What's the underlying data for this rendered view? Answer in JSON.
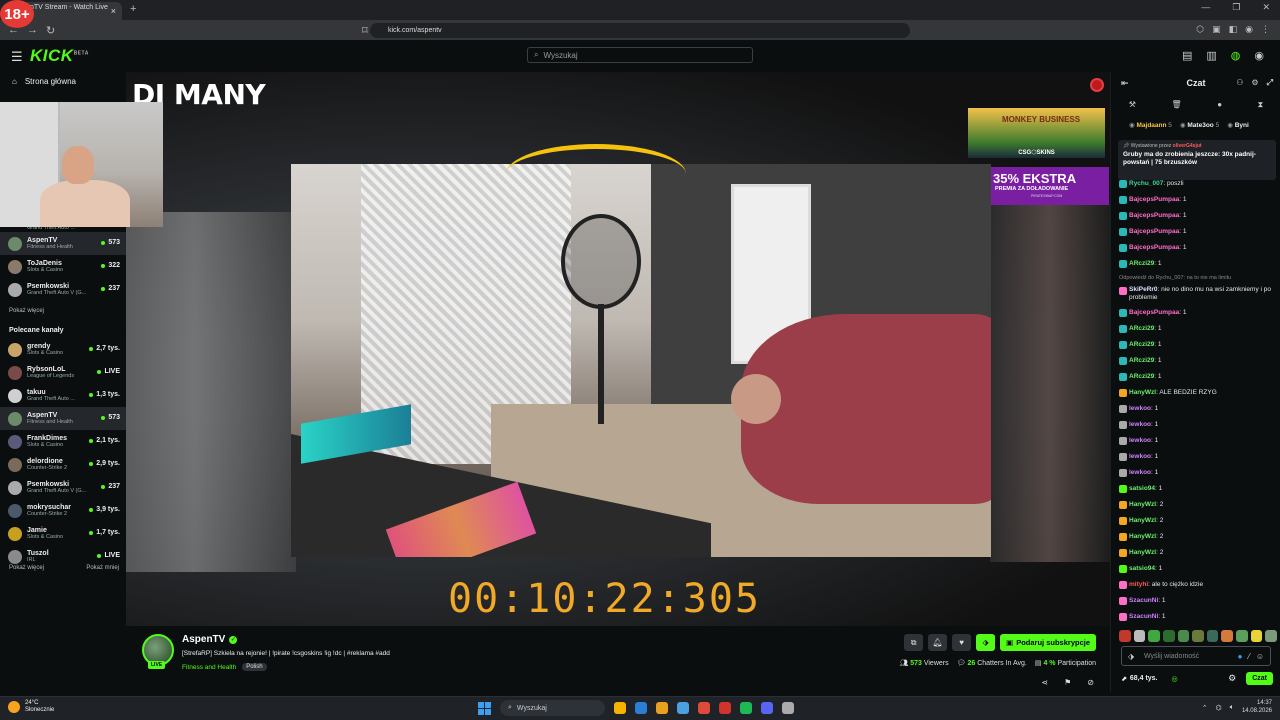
{
  "browser": {
    "age_badge": "18+",
    "tab_title": "nTV Stream - Watch Live o",
    "tab_close": "×",
    "new_tab": "+",
    "url": "kick.com/aspentv",
    "window_controls": [
      "—",
      "❐",
      "✕"
    ]
  },
  "header": {
    "logo": "KICK",
    "logo_tag": "BETA",
    "search_placeholder": "Wyszukaj"
  },
  "sidebar": {
    "home_label": "Strona główna",
    "followed_partial_category": "Grand Theft Auto ...",
    "followed": [
      {
        "name": "AspenTV",
        "category": "Fitness and Health",
        "viewers": "573",
        "active": true,
        "color": "#6a8a6a"
      },
      {
        "name": "ToJaDenis",
        "category": "Slots & Casino",
        "viewers": "322",
        "color": "#8a7a6a"
      },
      {
        "name": "Psemkowski",
        "category": "Grand Theft Auto V (G...",
        "viewers": "237",
        "color": "#aaaaaa"
      }
    ],
    "show_more": "Pokaż więcej",
    "recommended_title": "Polecane kanały",
    "recommended": [
      {
        "name": "grendy",
        "category": "Slots & Casino",
        "viewers": "2,7 tys.",
        "color": "#c9a36a"
      },
      {
        "name": "RybsonLoL",
        "category": "League of Legends",
        "viewers": "LIVE",
        "color": "#7a4a4a"
      },
      {
        "name": "takuu",
        "category": "Grand Theft Auto ...",
        "viewers": "1,3 tys.",
        "color": "#d0d0d0"
      },
      {
        "name": "AspenTV",
        "category": "Fitness and Health",
        "viewers": "573",
        "active": true,
        "color": "#6a8a6a"
      },
      {
        "name": "FrankDimes",
        "category": "Slots & Casino",
        "viewers": "2,1 tys.",
        "color": "#5a5a7a"
      },
      {
        "name": "delordione",
        "category": "Counter-Strike 2",
        "viewers": "2,9 tys.",
        "color": "#7a6a5a"
      },
      {
        "name": "Psemkowski",
        "category": "Grand Theft Auto V (G...",
        "viewers": "237",
        "color": "#aaaaaa"
      },
      {
        "name": "mokrysuchar",
        "category": "Counter-Strike 2",
        "viewers": "3,9 tys.",
        "color": "#4a5a6a"
      },
      {
        "name": "Jamie",
        "category": "Slots & Casino",
        "viewers": "1,7 tys.",
        "color": "#c8a020"
      },
      {
        "name": "Tuszol",
        "category": "IRL",
        "viewers": "LIVE",
        "color": "#8a8a8a"
      }
    ],
    "show_more_2": "Pokaż więcej",
    "show_less": "Pokaż mniej"
  },
  "video": {
    "overlay_logo": "DJ MANY",
    "timer": "00:10:22:305",
    "ad1_title": "MONKEY BUSINESS",
    "ad1_sub": "CSG⬡SKINS",
    "ad2_big": "35% EKSTRA",
    "ad2_small": "PREMIA ZA DOŁADOWANIE",
    "ad2_tiny": "PIRATESWAP.COM"
  },
  "stream_info": {
    "name": "AspenTV",
    "live": "LIVE",
    "title": "[StrefaRP] Szkiela na rejonie! | !pirate !csgoskins !ig !dc | #reklama #add",
    "category": "Fitness and Health",
    "language": "Polish",
    "subscribe_label": "Podaruj subskrypcje",
    "viewers": "573",
    "viewers_label": "Viewers",
    "chatters": "26",
    "chatters_label": "Chatters In Avg.",
    "participation": "4 %",
    "participation_label": "Participation"
  },
  "chat": {
    "title": "Czat",
    "gifters": [
      {
        "name": "Majdaann",
        "count": "5"
      },
      {
        "name": "Mate3oo",
        "count": "5"
      },
      {
        "name": "Byni",
        "count": ""
      }
    ],
    "pinned_by_label": "Wystawione przez",
    "pinned_by": "oliverG4sjut",
    "pinned_msg": "Gruby ma do zrobienia jeszcze: 30x padnij-powstań | 75 brzuszków",
    "messages": [
      {
        "user": "Rychu_007",
        "text": ": poszli",
        "color": "#3fd8a0",
        "badge": "#2ab8b8"
      },
      {
        "user": "BajcepsPumpaa",
        "text": ": 1",
        "color": "#ff6ec7",
        "badge": "#2ab8b8"
      },
      {
        "user": "BajcepsPumpaa",
        "text": ": 1",
        "color": "#ff6ec7",
        "badge": "#2ab8b8"
      },
      {
        "user": "BajcepsPumpaa",
        "text": ": 1",
        "color": "#ff6ec7",
        "badge": "#2ab8b8"
      },
      {
        "user": "BajcepsPumpaa",
        "text": ": 1",
        "color": "#ff6ec7",
        "badge": "#2ab8b8"
      },
      {
        "user": "ARczi29",
        "text": ": 1",
        "color": "#6cf06c",
        "badge": "#2ab8b8"
      },
      {
        "reply": "Odpowiedź do Rychu_007: na to nie ma limitu",
        "user": "SkiPeRr0",
        "text": ": nie no dino mu na wsi zamkniemy i po problemie",
        "color": "#e0e0ff",
        "badge": "#ff6ec7",
        "wrap": true
      },
      {
        "user": "BajcepsPumpaa",
        "text": ": 1",
        "color": "#ff6ec7",
        "badge": "#2ab8b8"
      },
      {
        "user": "ARczi29",
        "text": ": 1",
        "color": "#6cf06c",
        "badge": "#2ab8b8"
      },
      {
        "user": "ARczi29",
        "text": ": 1",
        "color": "#6cf06c",
        "badge": "#2ab8b8"
      },
      {
        "user": "ARczi29",
        "text": ": 1",
        "color": "#6cf06c",
        "badge": "#2ab8b8"
      },
      {
        "user": "ARczi29",
        "text": ": 1",
        "color": "#6cf06c",
        "badge": "#2ab8b8"
      },
      {
        "user": "HanyWzl",
        "text": ": ALE BEDZIE RZYG",
        "color": "#6cf06c",
        "badge": "#f5a623"
      },
      {
        "user": "lewkoo",
        "text": ": 1",
        "color": "#d080ff",
        "badge": "#aaaaaa"
      },
      {
        "user": "lewkoo",
        "text": ": 1",
        "color": "#d080ff",
        "badge": "#aaaaaa"
      },
      {
        "user": "lewkoo",
        "text": ": 1",
        "color": "#d080ff",
        "badge": "#aaaaaa"
      },
      {
        "user": "lewkoo",
        "text": ": 1",
        "color": "#d080ff",
        "badge": "#aaaaaa"
      },
      {
        "user": "lewkoo",
        "text": ": 1",
        "color": "#d080ff",
        "badge": "#aaaaaa"
      },
      {
        "user": "satsio94",
        "text": ": 1",
        "color": "#6cf06c",
        "badge": "#53fc18"
      },
      {
        "user": "HanyWzl",
        "text": ": 2",
        "color": "#6cf06c",
        "badge": "#f5a623"
      },
      {
        "user": "HanyWzl",
        "text": ": 2",
        "color": "#6cf06c",
        "badge": "#f5a623"
      },
      {
        "user": "HanyWzl",
        "text": ": 2",
        "color": "#6cf06c",
        "badge": "#f5a623"
      },
      {
        "user": "HanyWzl",
        "text": ": 2",
        "color": "#6cf06c",
        "badge": "#f5a623"
      },
      {
        "user": "satsio94",
        "text": ": 1",
        "color": "#6cf06c",
        "badge": "#53fc18"
      },
      {
        "user": "mityhi",
        "text": ": ale to ciężko idzie",
        "color": "#ff5a5a",
        "badge": "#ff6ec7"
      },
      {
        "user": "SzacunNi",
        "text": ": 1",
        "color": "#d080ff",
        "badge": "#ff6ec7"
      },
      {
        "user": "SzacunNi",
        "text": ": 1",
        "color": "#d080ff",
        "badge": "#ff6ec7"
      }
    ],
    "input_placeholder": "Wyślij wiadomość",
    "points": "68,4 tys.",
    "chat_button": "Czat"
  },
  "taskbar": {
    "temp": "24°C",
    "weather": "Słonecznie",
    "search": "Wyszukaj",
    "time": "14:37",
    "date": "14.08.2026",
    "apps": [
      "#f5b400",
      "#2a7fd4",
      "#e8a020",
      "#4aa0e0",
      "#e04a3a",
      "#d0342c",
      "#1db954",
      "#5865f2",
      "#aaaaaa"
    ]
  }
}
